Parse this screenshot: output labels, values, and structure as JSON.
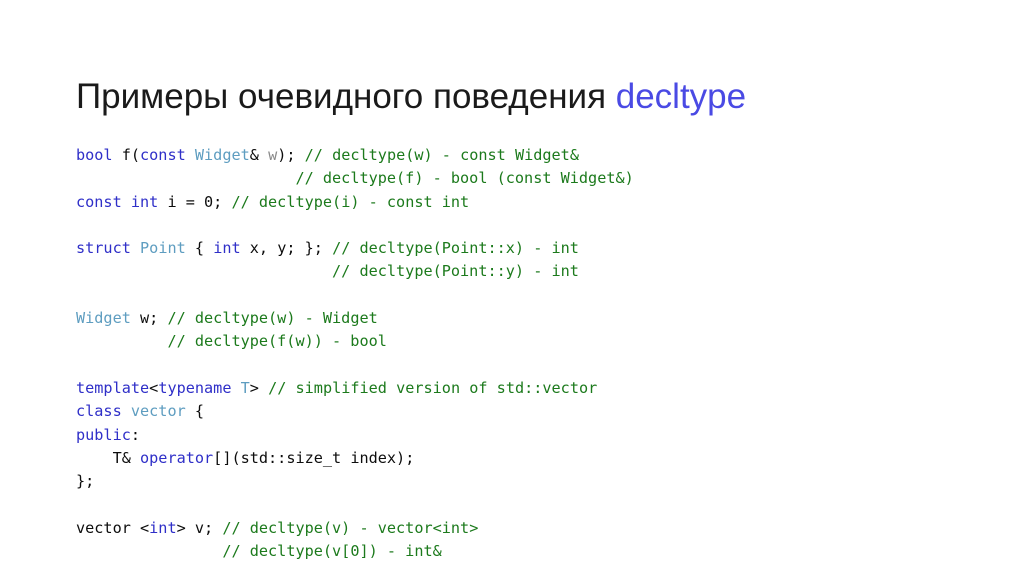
{
  "slide": {
    "title": {
      "text_main": "Примеры очевидного поведения ",
      "text_accent": "decltype",
      "accent_color": "#4a4ae4",
      "base_color": "#1a1a1a"
    },
    "background_color": "#ffffff"
  },
  "theme": {
    "keyword_color": "#2f2fc8",
    "type_color": "#5e9dc0",
    "comment_color": "#1c7a1c",
    "plain_color": "#0d0d0d",
    "dim_color": "#8a8a8a"
  },
  "code": {
    "language": "cpp",
    "lines": [
      {
        "id": "line-1",
        "tokens": [
          {
            "t": "bool",
            "c": "kw"
          },
          {
            "t": " f(",
            "c": "plain"
          },
          {
            "t": "const",
            "c": "kw"
          },
          {
            "t": " ",
            "c": "plain"
          },
          {
            "t": "Widget",
            "c": "type"
          },
          {
            "t": "& ",
            "c": "plain"
          },
          {
            "t": "w",
            "c": "dim"
          },
          {
            "t": "); ",
            "c": "plain"
          },
          {
            "t": "// decltype(w) - const Widget&",
            "c": "comment"
          }
        ],
        "plain_text": "bool f(const Widget& w); // decltype(w) - const Widget&"
      },
      {
        "id": "line-2",
        "tokens": [
          {
            "t": "                        ",
            "c": "plain"
          },
          {
            "t": "// decltype(f) - bool (const Widget&)",
            "c": "comment"
          }
        ],
        "plain_text": "                        // decltype(f) - bool (const Widget&)"
      },
      {
        "id": "line-3",
        "tokens": [
          {
            "t": "const",
            "c": "kw"
          },
          {
            "t": " ",
            "c": "plain"
          },
          {
            "t": "int",
            "c": "kw"
          },
          {
            "t": " i = 0; ",
            "c": "plain"
          },
          {
            "t": "// decltype(i) - const int",
            "c": "comment"
          }
        ],
        "plain_text": "const int i = 0; // decltype(i) - const int"
      },
      {
        "id": "line-4",
        "tokens": [],
        "plain_text": ""
      },
      {
        "id": "line-5",
        "tokens": [
          {
            "t": "struct",
            "c": "kw"
          },
          {
            "t": " ",
            "c": "plain"
          },
          {
            "t": "Point",
            "c": "type"
          },
          {
            "t": " { ",
            "c": "plain"
          },
          {
            "t": "int",
            "c": "kw"
          },
          {
            "t": " x, y; }; ",
            "c": "plain"
          },
          {
            "t": "// decltype(Point::x) - int",
            "c": "comment"
          }
        ],
        "plain_text": "struct Point { int x, y; }; // decltype(Point::x) - int"
      },
      {
        "id": "line-6",
        "tokens": [
          {
            "t": "                            ",
            "c": "plain"
          },
          {
            "t": "// decltype(Point::y) - int",
            "c": "comment"
          }
        ],
        "plain_text": "                            // decltype(Point::y) - int"
      },
      {
        "id": "line-7",
        "tokens": [],
        "plain_text": ""
      },
      {
        "id": "line-8",
        "tokens": [
          {
            "t": "Widget",
            "c": "type"
          },
          {
            "t": " w; ",
            "c": "plain"
          },
          {
            "t": "// decltype(w) - Widget",
            "c": "comment"
          }
        ],
        "plain_text": "Widget w; // decltype(w) - Widget"
      },
      {
        "id": "line-9",
        "tokens": [
          {
            "t": "          ",
            "c": "plain"
          },
          {
            "t": "// decltype(f(w)) - bool",
            "c": "comment"
          }
        ],
        "plain_text": "          // decltype(f(w)) - bool"
      },
      {
        "id": "line-10",
        "tokens": [],
        "plain_text": ""
      },
      {
        "id": "line-11",
        "tokens": [
          {
            "t": "template",
            "c": "kw"
          },
          {
            "t": "<",
            "c": "plain"
          },
          {
            "t": "typename",
            "c": "kw"
          },
          {
            "t": " ",
            "c": "plain"
          },
          {
            "t": "T",
            "c": "type"
          },
          {
            "t": "> ",
            "c": "plain"
          },
          {
            "t": "// simplified version of std::vector",
            "c": "comment"
          }
        ],
        "plain_text": "template<typename T> // simplified version of std::vector"
      },
      {
        "id": "line-12",
        "tokens": [
          {
            "t": "class",
            "c": "kw"
          },
          {
            "t": " ",
            "c": "plain"
          },
          {
            "t": "vector",
            "c": "type"
          },
          {
            "t": " {",
            "c": "plain"
          }
        ],
        "plain_text": "class vector {"
      },
      {
        "id": "line-13",
        "tokens": [
          {
            "t": "public",
            "c": "kw"
          },
          {
            "t": ":",
            "c": "plain"
          }
        ],
        "plain_text": "public:"
      },
      {
        "id": "line-14",
        "tokens": [
          {
            "t": "    T& ",
            "c": "plain"
          },
          {
            "t": "operator",
            "c": "kw"
          },
          {
            "t": "[](std::size_t index);",
            "c": "plain"
          }
        ],
        "plain_text": "    T& operator[](std::size_t index);"
      },
      {
        "id": "line-15",
        "tokens": [
          {
            "t": "};",
            "c": "plain"
          }
        ],
        "plain_text": "};"
      },
      {
        "id": "line-16",
        "tokens": [],
        "plain_text": ""
      },
      {
        "id": "line-17",
        "tokens": [
          {
            "t": "vector <",
            "c": "plain"
          },
          {
            "t": "int",
            "c": "kw"
          },
          {
            "t": "> v; ",
            "c": "plain"
          },
          {
            "t": "// decltype(v) - vector<int>",
            "c": "comment"
          }
        ],
        "plain_text": "vector <int> v; // decltype(v) - vector<int>"
      },
      {
        "id": "line-18",
        "tokens": [
          {
            "t": "                ",
            "c": "plain"
          },
          {
            "t": "// decltype(v[0]) - int&",
            "c": "comment"
          }
        ],
        "plain_text": "                // decltype(v[0]) - int&"
      }
    ]
  }
}
